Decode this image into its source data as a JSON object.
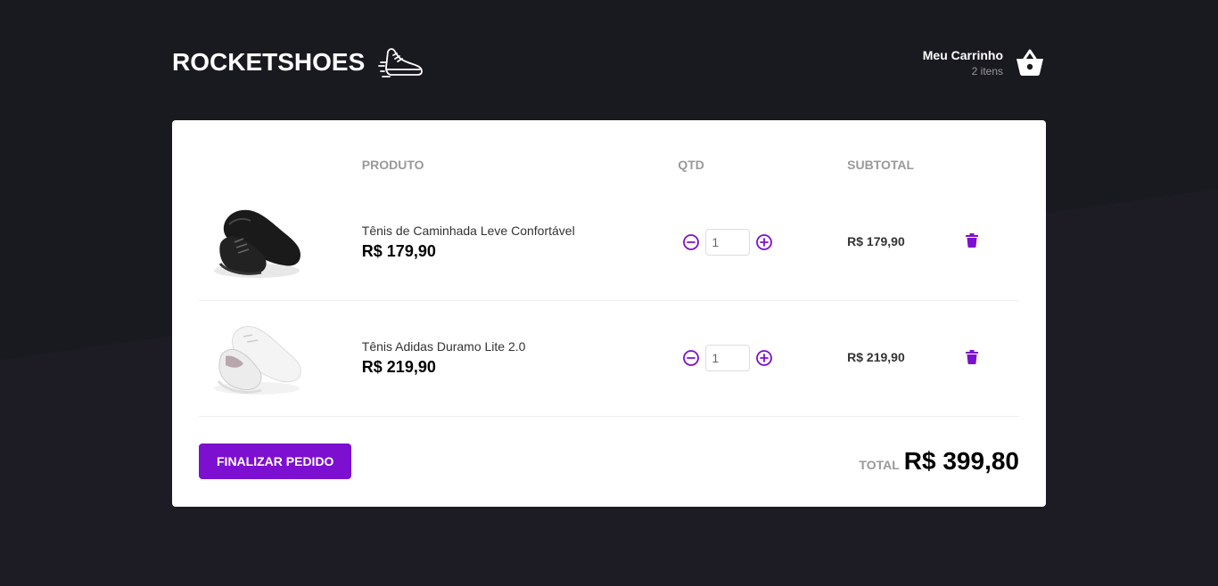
{
  "header": {
    "logo_text": "ROCKETSHOES",
    "logo_icon": "running-shoe-icon",
    "cart_title": "Meu Carrinho",
    "cart_count": "2 itens",
    "cart_icon": "shopping-basket-icon"
  },
  "table": {
    "columns": [
      "PRODUTO",
      "QTD",
      "SUBTOTAL"
    ],
    "items": [
      {
        "image": "black-sneaker",
        "title": "Tênis de Caminhada Leve Confortável",
        "price": "R$ 179,90",
        "quantity": "1",
        "subtotal": "R$ 179,90"
      },
      {
        "image": "white-sneaker",
        "title": "Tênis Adidas Duramo Lite 2.0",
        "price": "R$ 219,90",
        "quantity": "1",
        "subtotal": "R$ 219,90"
      }
    ]
  },
  "footer": {
    "checkout_label": "FINALIZAR PEDIDO",
    "total_label": "TOTAL",
    "total_value": "R$ 399,80"
  },
  "colors": {
    "background": "#191920",
    "accent": "#7d0fd0",
    "card": "#ffffff"
  }
}
